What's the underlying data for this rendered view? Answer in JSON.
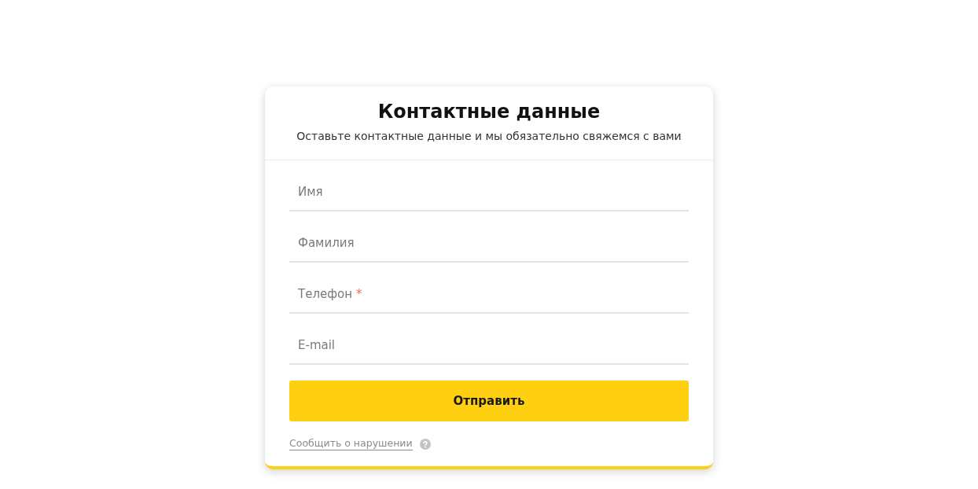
{
  "form": {
    "title": "Контактные данные",
    "subtitle": "Оставьте контактные данные и мы обязательно свяжемся с вами",
    "fields": [
      {
        "label": "Имя",
        "required": false
      },
      {
        "label": "Фамилия",
        "required": false
      },
      {
        "label": "Телефон",
        "required": true
      },
      {
        "label": "E-mail",
        "required": false
      }
    ],
    "required_mark": "*",
    "submit": "Отправить",
    "report_link": "Сообщить о нарушении"
  }
}
